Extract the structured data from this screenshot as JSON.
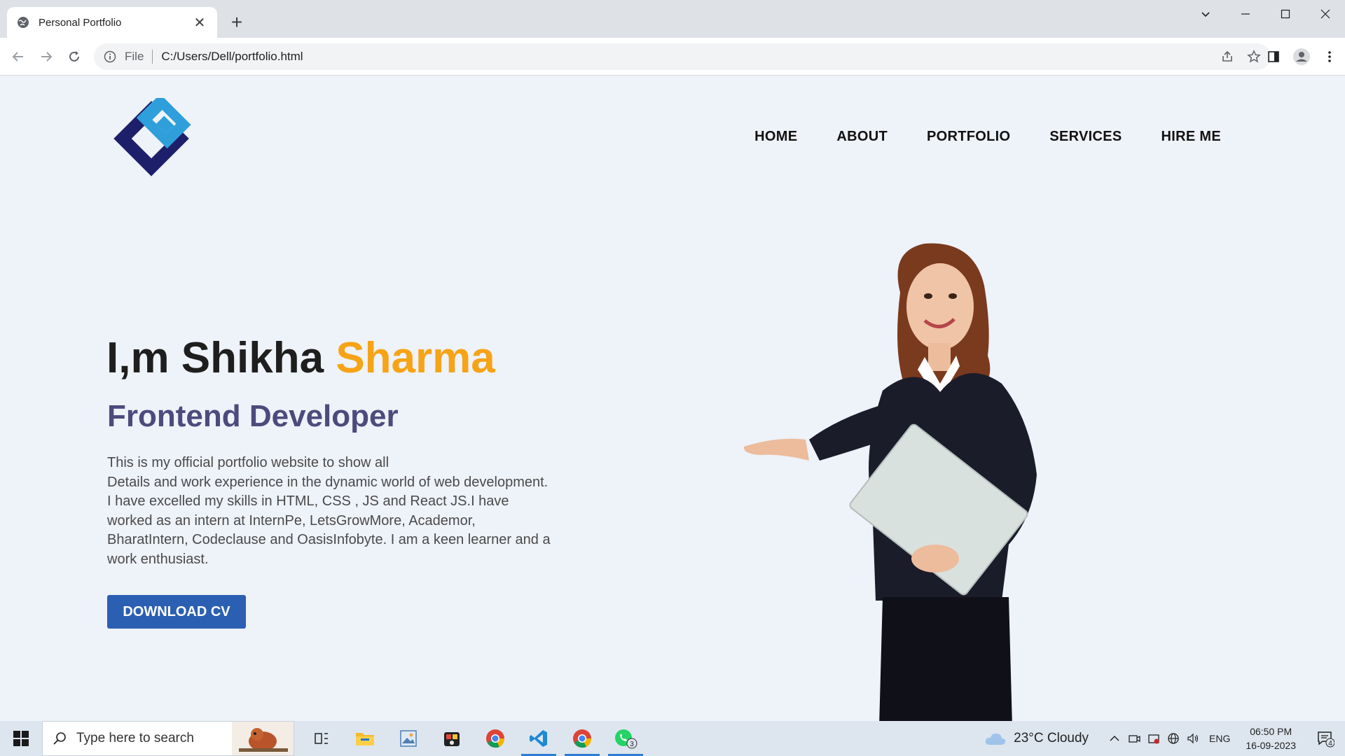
{
  "browser": {
    "tab_title": "Personal Portfolio",
    "new_tab_symbol": "+",
    "scheme": "File",
    "url": "C:/Users/Dell/portfolio.html"
  },
  "site": {
    "nav": [
      "HOME",
      "ABOUT",
      "PORTFOLIO",
      "SERVICES",
      "HIRE ME"
    ],
    "hero": {
      "greeting": "I,m Shikha ",
      "name_accent": "Sharma",
      "role": "Frontend Developer",
      "bio_lines": [
        "This is my official portfolio website to show all",
        "Details and work experience in the dynamic world of web development.",
        "I have excelled my skills in HTML, CSS , JS and React JS.I have",
        "worked as an intern at InternPe, LetsGrowMore, Academor,",
        "BharatIntern, Codeclause and OasisInfobyte. I am a keen learner and a",
        "work enthusiast."
      ],
      "cta": "DOWNLOAD CV"
    },
    "colors": {
      "accent": "#f6a316",
      "role": "#4c4b7c",
      "button": "#2b5fb2",
      "logo_dark": "#1e1f6b",
      "logo_light": "#2e9fdb"
    }
  },
  "taskbar": {
    "search_placeholder": "Type here to search",
    "weather": "23°C  Cloudy",
    "language": "ENG",
    "time": "06:50 PM",
    "date": "16-09-2023",
    "whatsapp_badge": "3",
    "notification_count": "4"
  }
}
